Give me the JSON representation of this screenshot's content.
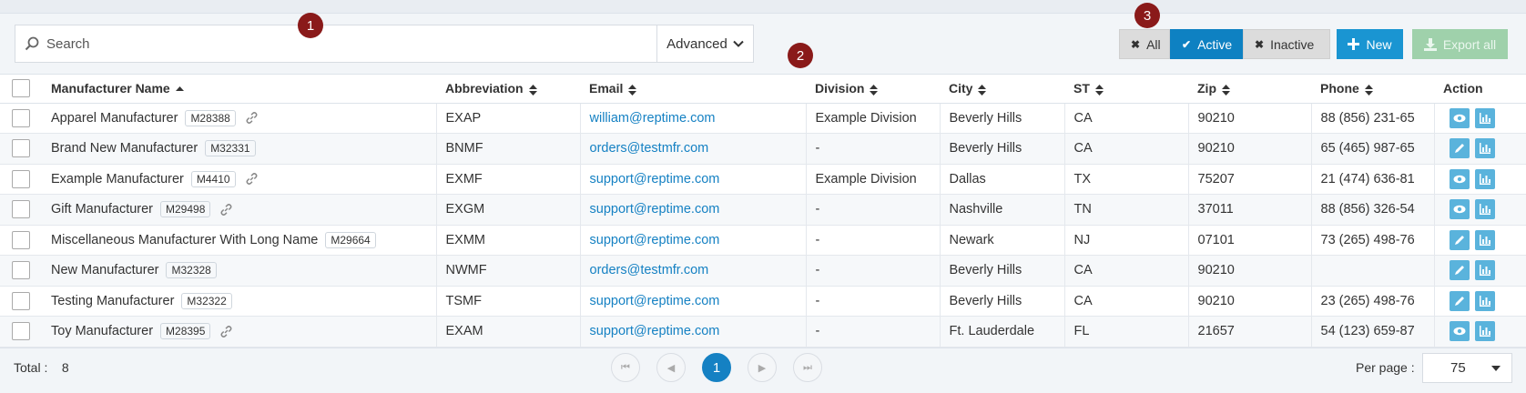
{
  "search": {
    "placeholder": "Search",
    "advanced_label": "Advanced"
  },
  "annotations": [
    "1",
    "2",
    "3"
  ],
  "filters": {
    "all": "All",
    "active": "Active",
    "inactive": "Inactive"
  },
  "buttons": {
    "new": "New",
    "export": "Export all"
  },
  "columns": [
    "Manufacturer Name",
    "Abbreviation",
    "Email",
    "Division",
    "City",
    "ST",
    "Zip",
    "Phone",
    "Action"
  ],
  "rows": [
    {
      "name": "Apparel Manufacturer",
      "code": "M28388",
      "link": true,
      "abbr": "EXAP",
      "email": "william@reptime.com",
      "division": "Example Division",
      "city": "Beverly Hills",
      "st": "CA",
      "zip": "90210",
      "phone": "88 (856) 231-65",
      "action": "view"
    },
    {
      "name": "Brand New Manufacturer",
      "code": "M32331",
      "link": false,
      "abbr": "BNMF",
      "email": "orders@testmfr.com",
      "division": "-",
      "city": "Beverly Hills",
      "st": "CA",
      "zip": "90210",
      "phone": "65 (465) 987-65",
      "action": "edit"
    },
    {
      "name": "Example Manufacturer",
      "code": "M4410",
      "link": true,
      "abbr": "EXMF",
      "email": "support@reptime.com",
      "division": "Example Division",
      "city": "Dallas",
      "st": "TX",
      "zip": "75207",
      "phone": "21 (474) 636-81",
      "action": "view"
    },
    {
      "name": "Gift Manufacturer",
      "code": "M29498",
      "link": true,
      "abbr": "EXGM",
      "email": "support@reptime.com",
      "division": "-",
      "city": "Nashville",
      "st": "TN",
      "zip": "37011",
      "phone": "88 (856) 326-54",
      "action": "view"
    },
    {
      "name": "Miscellaneous Manufacturer With Long Name",
      "code": "M29664",
      "link": false,
      "abbr": "EXMM",
      "email": "support@reptime.com",
      "division": "-",
      "city": "Newark",
      "st": "NJ",
      "zip": "07101",
      "phone": "73 (265) 498-76",
      "action": "edit"
    },
    {
      "name": "New Manufacturer",
      "code": "M32328",
      "link": false,
      "abbr": "NWMF",
      "email": "orders@testmfr.com",
      "division": "-",
      "city": "Beverly Hills",
      "st": "CA",
      "zip": "90210",
      "phone": "",
      "action": "edit"
    },
    {
      "name": "Testing Manufacturer",
      "code": "M32322",
      "link": false,
      "abbr": "TSMF",
      "email": "support@reptime.com",
      "division": "-",
      "city": "Beverly Hills",
      "st": "CA",
      "zip": "90210",
      "phone": "23 (265) 498-76",
      "action": "edit"
    },
    {
      "name": "Toy Manufacturer",
      "code": "M28395",
      "link": true,
      "abbr": "EXAM",
      "email": "support@reptime.com",
      "division": "-",
      "city": "Ft. Lauderdale",
      "st": "FL",
      "zip": "21657",
      "phone": "54 (123) 659-87",
      "action": "view"
    }
  ],
  "footer": {
    "total_label": "Total :",
    "total_value": "8",
    "current_page": "1",
    "per_page_label": "Per page :",
    "per_page_value": "75"
  }
}
